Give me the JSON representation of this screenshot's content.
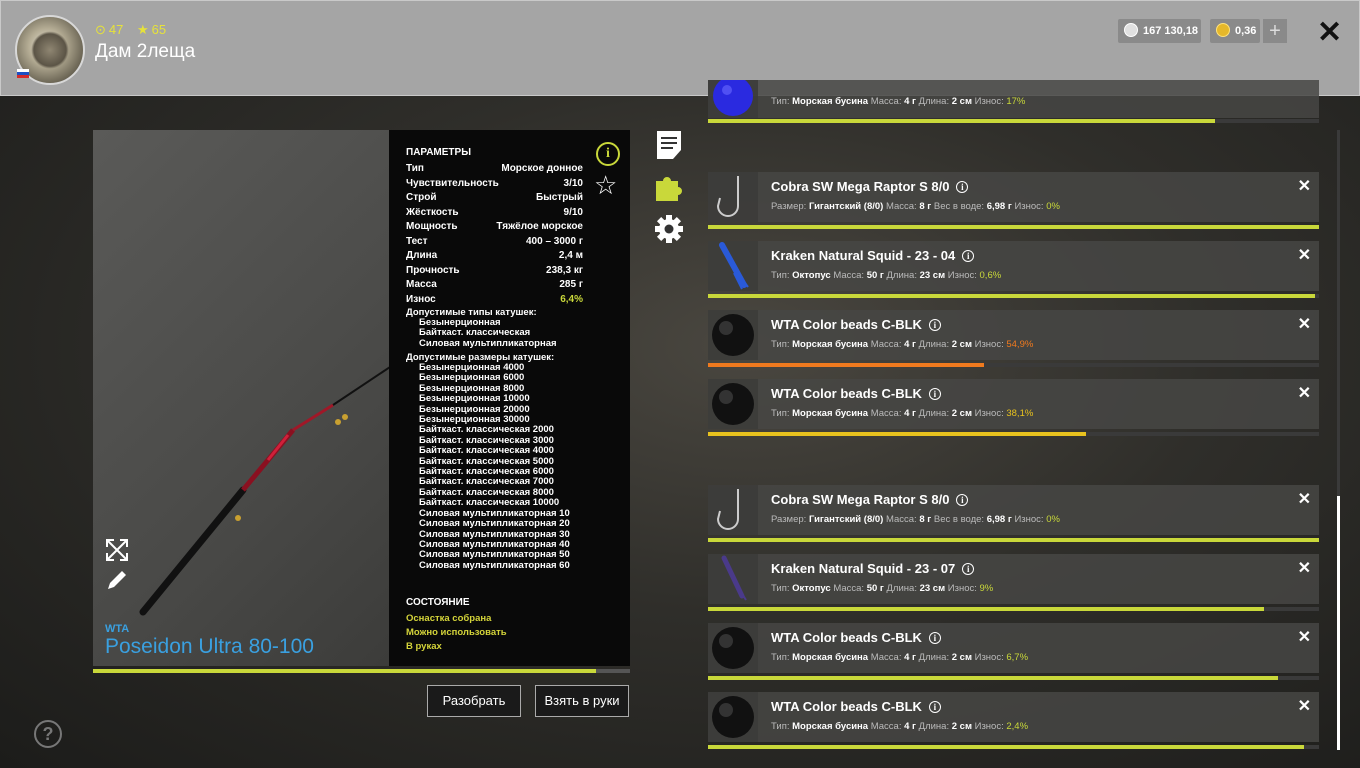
{
  "player": {
    "name": "Дам 2леща",
    "level": "47",
    "rank": "65",
    "flag_colors": [
      "#ffffff",
      "#1c4fc4",
      "#d42a2a"
    ]
  },
  "currency": {
    "silver": "167 130,18",
    "gold": "0,36",
    "add": "+"
  },
  "close": "✕",
  "rod": {
    "brand": "WTA",
    "name": "Poseidon Ultra 80-100",
    "durability_fraction": 0.936
  },
  "params": {
    "title": "ПАРАМЕТРЫ",
    "rows": [
      {
        "k": "Тип",
        "v": "Морское донное"
      },
      {
        "k": "Чувствительность",
        "v": "3/10"
      },
      {
        "k": "Строй",
        "v": "Быстрый"
      },
      {
        "k": "Жёсткость",
        "v": "9/10"
      },
      {
        "k": "Мощность",
        "v": "Тяжёлое морское"
      },
      {
        "k": "Тест",
        "v": "400 – 3000 г"
      },
      {
        "k": "Длина",
        "v": "2,4 м"
      },
      {
        "k": "Прочность",
        "v": "238,3 кг"
      },
      {
        "k": "Масса",
        "v": "285 г"
      },
      {
        "k": "Износ",
        "v": "6,4%"
      }
    ],
    "reel_types_title": "Допустимые типы катушек:",
    "reel_types": [
      "Безынерционная",
      "Байткаст. классическая",
      "Силовая мультипликаторная"
    ],
    "reel_sizes_title": "Допустимые размеры катушек:",
    "reel_sizes": [
      "Безынерционная 4000",
      "Безынерционная 6000",
      "Безынерционная 8000",
      "Безынерционная 10000",
      "Безынерционная 20000",
      "Безынерционная 30000",
      "Байткаст. классическая 2000",
      "Байткаст. классическая 3000",
      "Байткаст. классическая 4000",
      "Байткаст. классическая 5000",
      "Байткаст. классическая 6000",
      "Байткаст. классическая 7000",
      "Байткаст. классическая 8000",
      "Байткаст. классическая 10000",
      "Силовая мультипликаторная 10",
      "Силовая мультипликаторная 20",
      "Силовая мультипликаторная 30",
      "Силовая мультипликаторная 40",
      "Силовая мультипликаторная 50",
      "Силовая мультипликаторная 60"
    ],
    "state_title": "СОСТОЯНИЕ",
    "state": [
      "Оснастка собрана",
      "Можно использовать",
      "В руках"
    ]
  },
  "buttons": {
    "disassemble": "Разобрать",
    "take": "Взять в руки"
  },
  "help": "?",
  "items": [
    {
      "name": "",
      "desc": [
        [
          "Тип:",
          "Морская бусина"
        ],
        [
          "Масса:",
          "4 г"
        ],
        [
          "Длина:",
          "2 см"
        ]
      ],
      "wear_label": "Износ:",
      "wear": "17%",
      "wear_color": "#c9d83a",
      "fill": 0.83,
      "thumb": "blue-bead"
    },
    {
      "name": "Cobra SW Mega Raptor S 8/0",
      "desc": [
        [
          "Размер:",
          "Гигантский (8/0)"
        ],
        [
          "Масса:",
          "8 г"
        ],
        [
          "Вес в воде:",
          "6,98 г"
        ]
      ],
      "wear_label": "Износ:",
      "wear": "0%",
      "wear_color": "#c9d83a",
      "fill": 1.0,
      "thumb": "hook"
    },
    {
      "name": "Kraken Natural Squid - 23 - 04",
      "desc": [
        [
          "Тип:",
          "Октопус"
        ],
        [
          "Масса:",
          "50 г"
        ],
        [
          "Длина:",
          "23 см"
        ]
      ],
      "wear_label": "Износ:",
      "wear": "0,6%",
      "wear_color": "#c9d83a",
      "fill": 0.994,
      "thumb": "squid-blue"
    },
    {
      "name": "WTA Color beads C-BLK",
      "desc": [
        [
          "Тип:",
          "Морская бусина"
        ],
        [
          "Масса:",
          "4 г"
        ],
        [
          "Длина:",
          "2 см"
        ]
      ],
      "wear_label": "Износ:",
      "wear": "54,9%",
      "wear_color": "#f07a1e",
      "fill": 0.451,
      "thumb": "black-bead"
    },
    {
      "name": "WTA Color beads C-BLK",
      "desc": [
        [
          "Тип:",
          "Морская бусина"
        ],
        [
          "Масса:",
          "4 г"
        ],
        [
          "Длина:",
          "2 см"
        ]
      ],
      "wear_label": "Износ:",
      "wear": "38,1%",
      "wear_color": "#e8c21e",
      "fill": 0.619,
      "thumb": "black-bead"
    },
    {
      "name": "Cobra SW Mega Raptor S 8/0",
      "desc": [
        [
          "Размер:",
          "Гигантский (8/0)"
        ],
        [
          "Масса:",
          "8 г"
        ],
        [
          "Вес в воде:",
          "6,98 г"
        ]
      ],
      "wear_label": "Износ:",
      "wear": "0%",
      "wear_color": "#c9d83a",
      "fill": 1.0,
      "thumb": "hook"
    },
    {
      "name": "Kraken Natural Squid - 23 - 07",
      "desc": [
        [
          "Тип:",
          "Октопус"
        ],
        [
          "Масса:",
          "50 г"
        ],
        [
          "Длина:",
          "23 см"
        ]
      ],
      "wear_label": "Износ:",
      "wear": "9%",
      "wear_color": "#c9d83a",
      "fill": 0.91,
      "thumb": "squid-purple"
    },
    {
      "name": "WTA Color beads C-BLK",
      "desc": [
        [
          "Тип:",
          "Морская бусина"
        ],
        [
          "Масса:",
          "4 г"
        ],
        [
          "Длина:",
          "2 см"
        ]
      ],
      "wear_label": "Износ:",
      "wear": "6,7%",
      "wear_color": "#c9d83a",
      "fill": 0.933,
      "thumb": "black-bead"
    },
    {
      "name": "WTA Color beads C-BLK",
      "desc": [
        [
          "Тип:",
          "Морская бусина"
        ],
        [
          "Масса:",
          "4 г"
        ],
        [
          "Длина:",
          "2 см"
        ]
      ],
      "wear_label": "Износ:",
      "wear": "2,4%",
      "wear_color": "#c9d83a",
      "fill": 0.976,
      "thumb": "black-bead"
    }
  ],
  "colors": {
    "accent": "#c9d83a",
    "rod_name": "#3aa0e0"
  }
}
